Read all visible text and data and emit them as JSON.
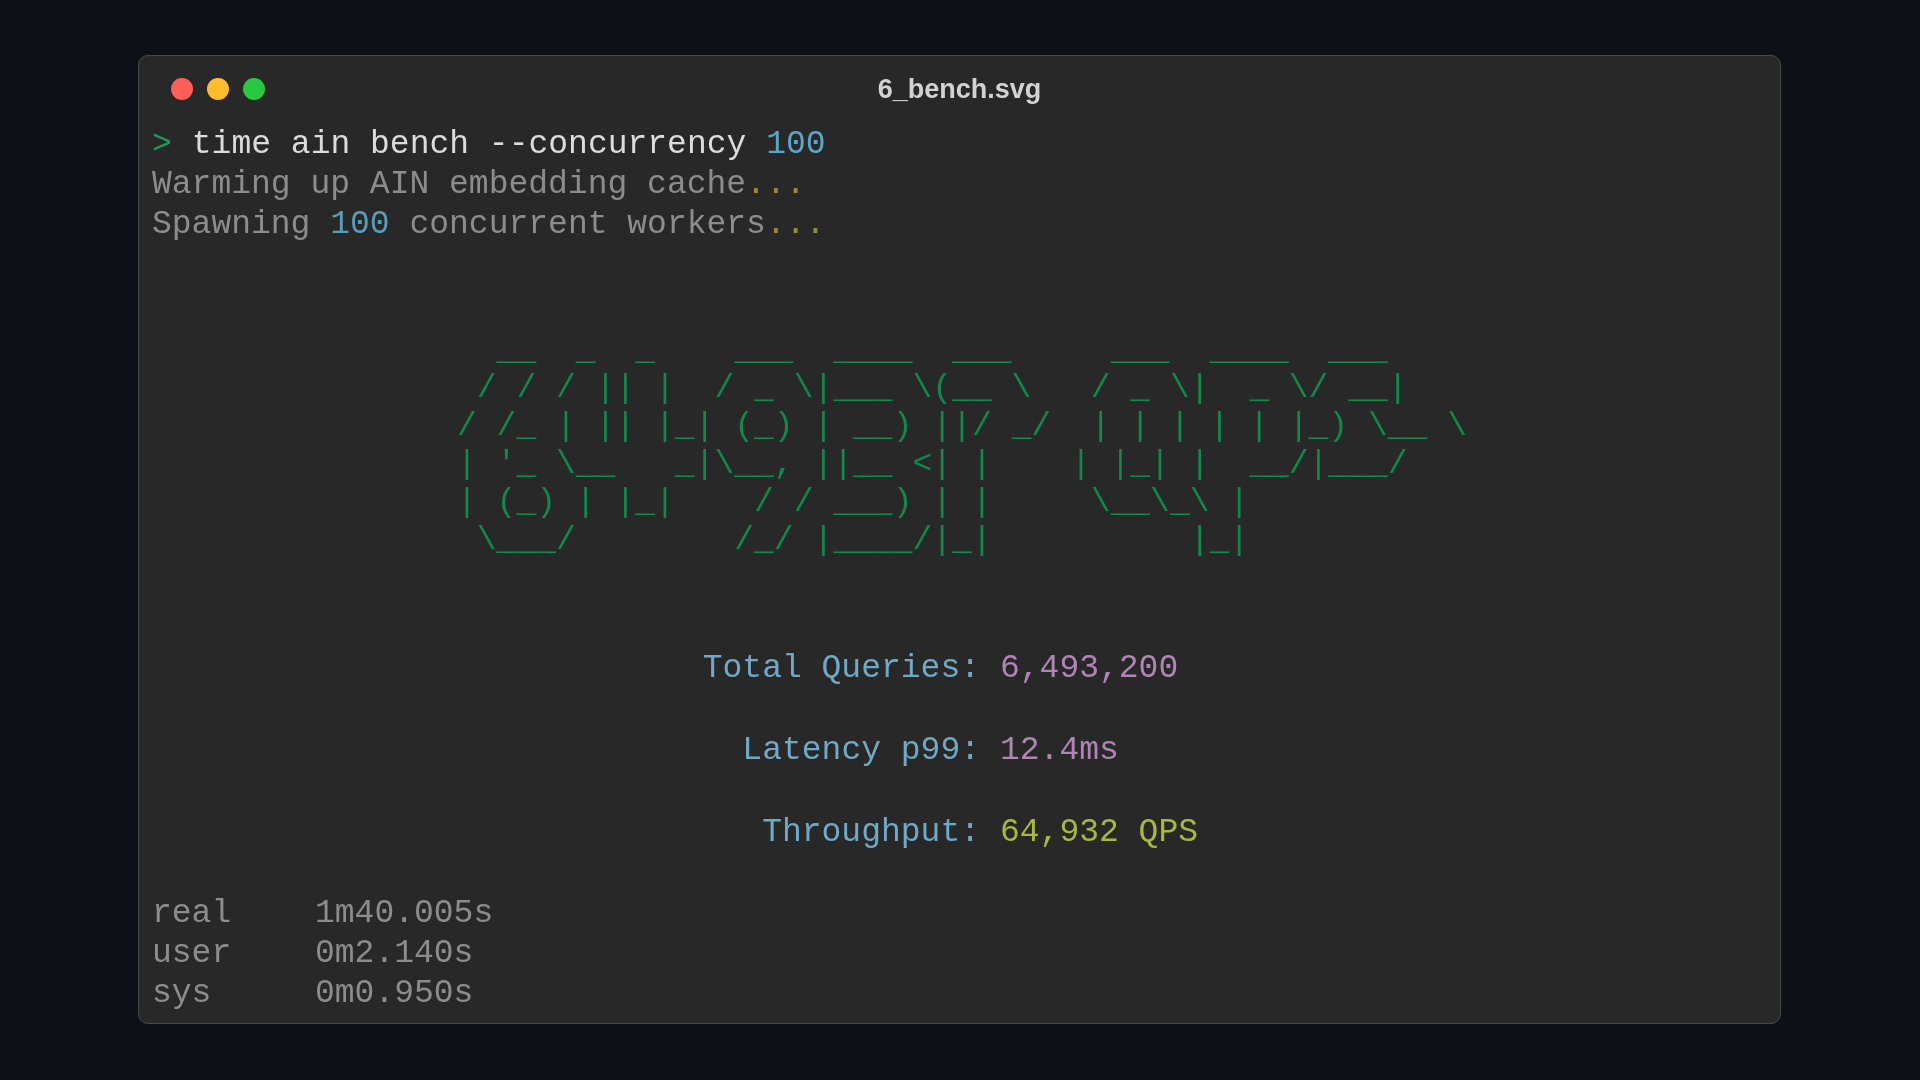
{
  "window": {
    "title": "6_bench.svg",
    "controls": [
      {
        "kind": "close"
      },
      {
        "kind": "minimize"
      },
      {
        "kind": "zoom"
      }
    ]
  },
  "prompt": {
    "symbol": ">",
    "command": "time ain bench --concurrency",
    "argument": "100"
  },
  "output": [
    {
      "segments": [
        {
          "kind": "plain",
          "text": "Warming up AIN embedding cache"
        },
        {
          "kind": "ellipsis",
          "text": "..."
        }
      ]
    },
    {
      "segments": [
        {
          "kind": "plain",
          "text": "Spawning "
        },
        {
          "kind": "number",
          "text": "100"
        },
        {
          "kind": "plain",
          "text": " concurrent workers"
        },
        {
          "kind": "ellipsis",
          "text": "..."
        }
      ]
    }
  ],
  "banner": {
    "lines": [
      "  __  _  _    ___  ____  ___     ___  ____  ___",
      " / / / || |  / _ \\|___ \\(__ \\   / _ \\|  _ \\/ __|",
      "/ /_ | || |_| (_) | __) ||/ _/  | | | | | |_) \\__ \\",
      "| '_ \\__   _|\\__, ||__ <| |    | |_| |  __/|___/",
      "| (_) | |_|    / / ___) | |     \\__\\_\\ |",
      " \\___/        /_/ |____/|_|          |_|"
    ]
  },
  "stats": [
    {
      "label": "Total Queries:",
      "value": "6,493,200",
      "color": "#b085b5"
    },
    {
      "label": "Latency p99:",
      "value": "12.4ms",
      "color": "#b085b5"
    },
    {
      "label": "Throughput:",
      "value": "64,932 QPS",
      "color": "#a9b83f"
    }
  ],
  "timing": [
    {
      "label": "real",
      "value": "1m40.005s"
    },
    {
      "label": "user",
      "value": "0m2.140s"
    },
    {
      "label": "sys",
      "value": "0m0.950s"
    }
  ]
}
